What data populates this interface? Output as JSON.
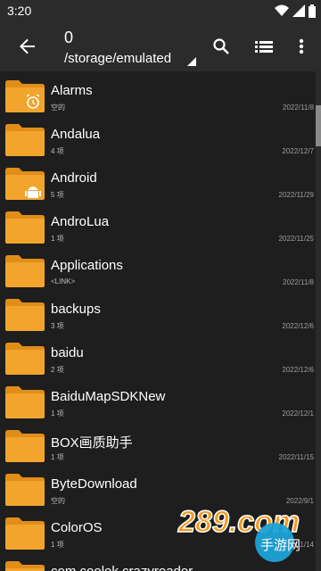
{
  "status": {
    "time": "3:20"
  },
  "appbar": {
    "count": "0",
    "path": "/storage/emulated"
  },
  "files": [
    {
      "name": "Alarms",
      "meta": "空的",
      "date": "2022/11/8",
      "badge": "alarm"
    },
    {
      "name": "Andalua",
      "meta": "4 项",
      "date": "2022/12/7",
      "badge": ""
    },
    {
      "name": "Android",
      "meta": "5 项",
      "date": "2022/11/29",
      "badge": "android"
    },
    {
      "name": "AndroLua",
      "meta": "1 项",
      "date": "2022/11/25",
      "badge": ""
    },
    {
      "name": "Applications",
      "meta": "<LINK>",
      "date": "2022/11/8",
      "badge": ""
    },
    {
      "name": "backups",
      "meta": "3 项",
      "date": "2022/12/6",
      "badge": ""
    },
    {
      "name": "baidu",
      "meta": "2 项",
      "date": "2022/12/6",
      "badge": ""
    },
    {
      "name": "BaiduMapSDKNew",
      "meta": "1 项",
      "date": "2022/12/1",
      "badge": ""
    },
    {
      "name": "BOX画质助手",
      "meta": "1 项",
      "date": "2022/11/15",
      "badge": ""
    },
    {
      "name": "ByteDownload",
      "meta": "空的",
      "date": "2022/9/1",
      "badge": ""
    },
    {
      "name": "ColorOS",
      "meta": "1 项",
      "date": "2022/11/14",
      "badge": ""
    },
    {
      "name": "com.coolek.crazyreader",
      "meta": "",
      "date": "",
      "badge": ""
    }
  ],
  "watermark": {
    "text": "289.com",
    "sub": "手游网"
  },
  "colors": {
    "folder": "#f2a42c",
    "folder_dark": "#e08d1a",
    "appbar": "#2b2b2b",
    "background": "#1e1e1e"
  }
}
